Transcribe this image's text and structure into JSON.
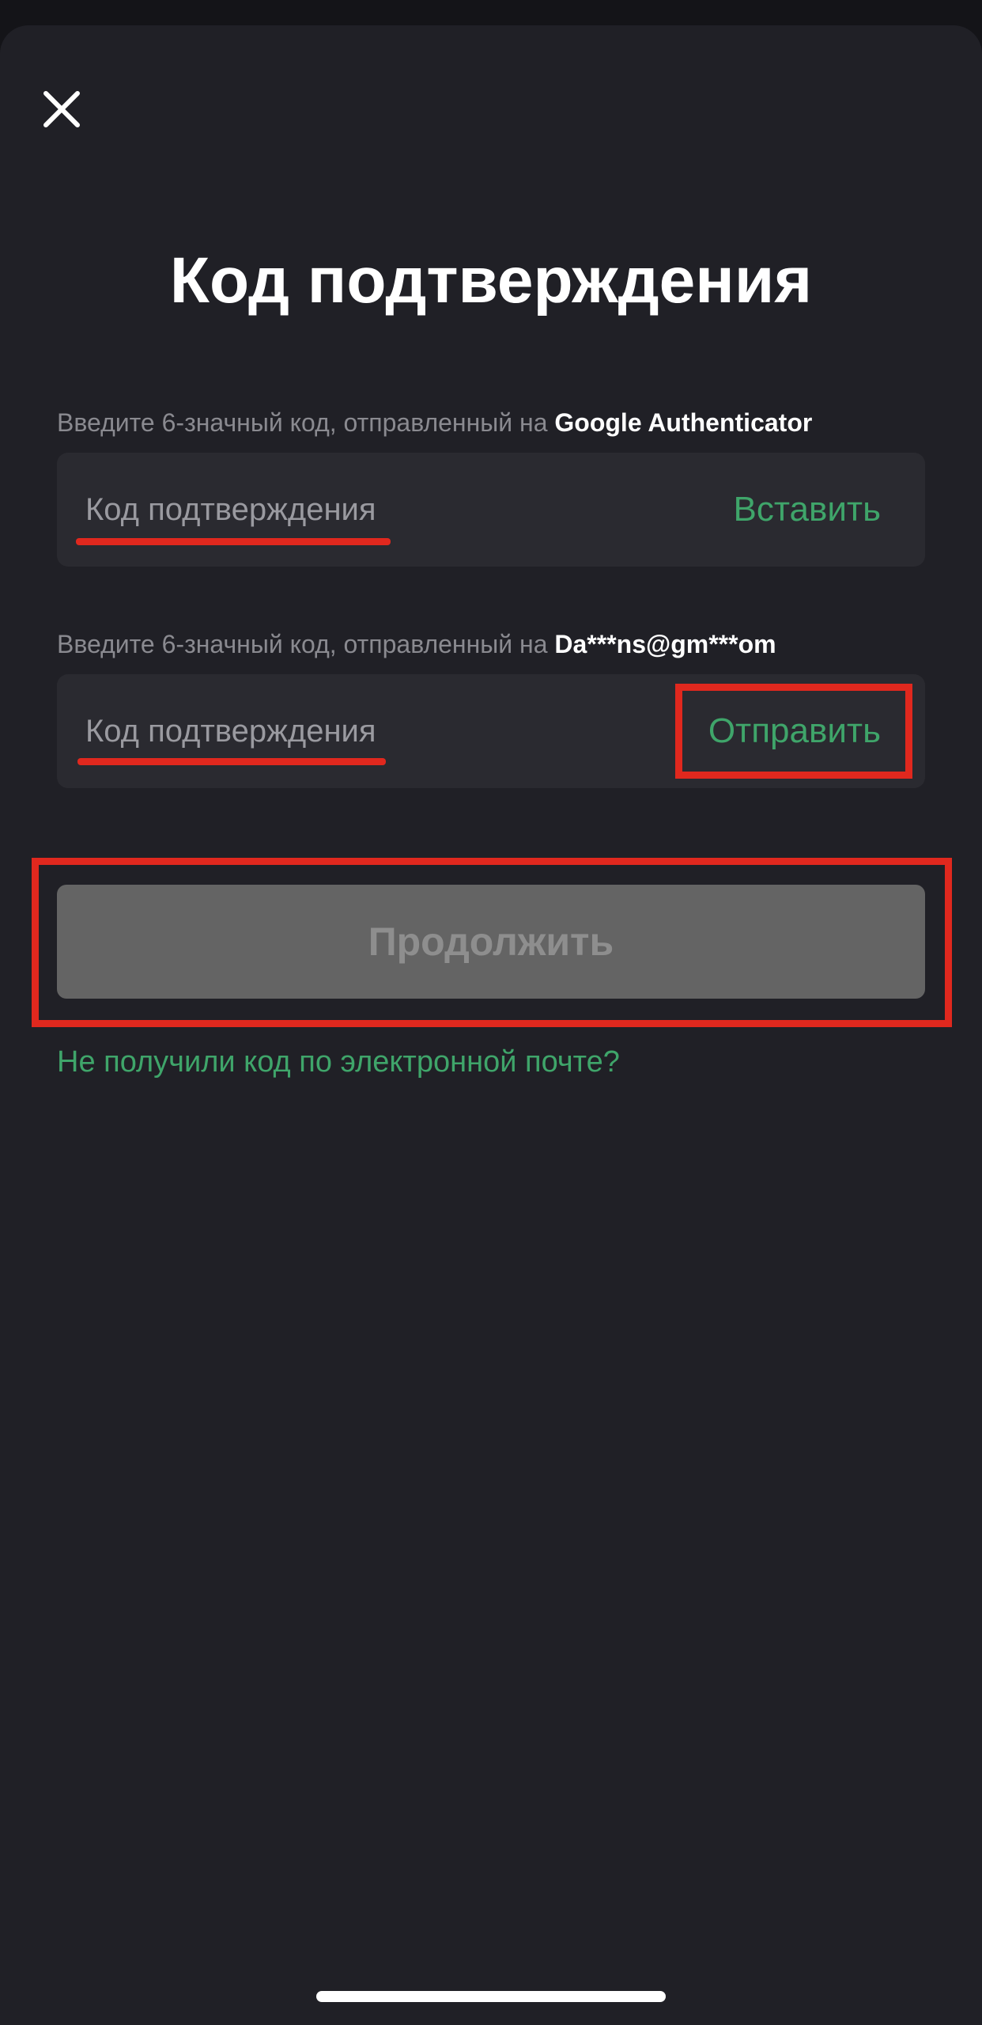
{
  "title": "Код подтверждения",
  "authenticator": {
    "label_prefix": "Введите 6-значный код, отправленный на ",
    "label_target": "Google Authenticator",
    "placeholder": "Код подтверждения",
    "action_label": "Вставить"
  },
  "email": {
    "label_prefix": "Введите 6-значный код, отправленный на ",
    "label_target": "Da***ns@gm***om",
    "placeholder": "Код подтверждения",
    "action_label": "Отправить"
  },
  "continue_label": "Продолжить",
  "no_code_link": "Не получили код по электронной почте?",
  "colors": {
    "accent": "#3fa56a",
    "background": "#202026",
    "field": "#2a2a30",
    "disabled_button": "#646464",
    "annotation_red": "#e0281e"
  },
  "icons": {
    "close": "close-icon"
  }
}
